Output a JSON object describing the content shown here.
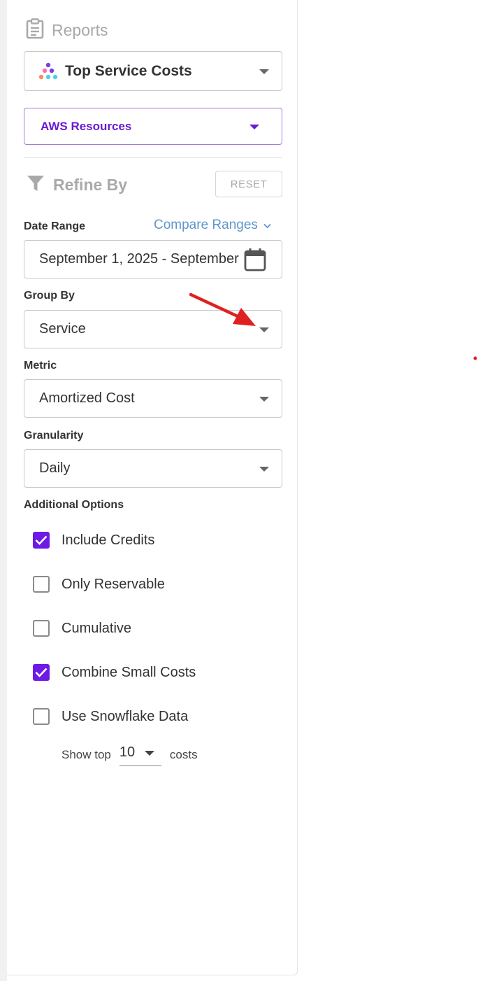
{
  "reports": {
    "title": "Reports"
  },
  "report_select": {
    "value": "Top Service Costs"
  },
  "resource_select": {
    "value": "AWS Resources"
  },
  "refine": {
    "title": "Refine By",
    "reset_label": "RESET"
  },
  "date_range": {
    "label": "Date Range",
    "compare_label": "Compare Ranges",
    "value": "September 1, 2025 - September"
  },
  "group_by": {
    "label": "Group By",
    "value": "Service"
  },
  "metric": {
    "label": "Metric",
    "value": "Amortized Cost"
  },
  "granularity": {
    "label": "Granularity",
    "value": "Daily"
  },
  "additional": {
    "label": "Additional Options",
    "options": [
      {
        "label": "Include Credits",
        "checked": true
      },
      {
        "label": "Only Reservable",
        "checked": false
      },
      {
        "label": "Cumulative",
        "checked": false
      },
      {
        "label": "Combine Small Costs",
        "checked": true
      },
      {
        "label": "Use Snowflake Data",
        "checked": false
      }
    ]
  },
  "show_top": {
    "prefix": "Show top",
    "value": "10",
    "suffix": "costs"
  },
  "colors": {
    "accent": "#6f19e6",
    "link": "#5f95cc",
    "annotation_arrow": "#e02020"
  }
}
